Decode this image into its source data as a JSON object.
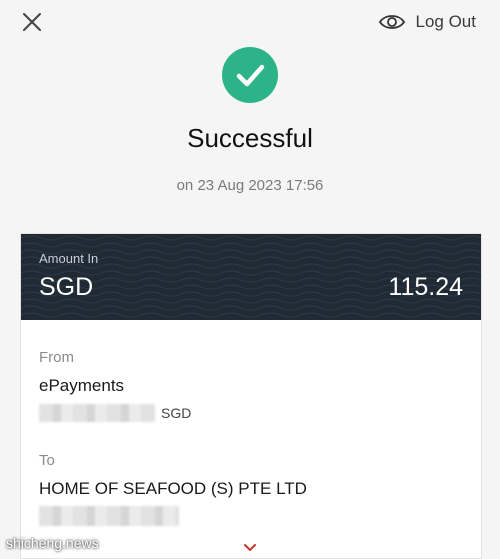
{
  "header": {
    "close_icon": "close-icon",
    "logout_icon": "eye-icon",
    "logout_label": "Log Out"
  },
  "status": {
    "icon": "check-circle-icon",
    "icon_color": "#2cb387",
    "title": "Successful",
    "date": "on 23 Aug 2023 17:56"
  },
  "amount": {
    "label": "Amount In",
    "currency": "SGD",
    "value": "115.24",
    "background": "#1f2a35"
  },
  "from": {
    "label": "From",
    "name": "ePayments",
    "currency": "SGD"
  },
  "to": {
    "label": "To",
    "name": "HOME OF SEAFOOD (S) PTE LTD"
  },
  "expand_icon": "chevron-down-icon",
  "watermark": "shicheng.news"
}
